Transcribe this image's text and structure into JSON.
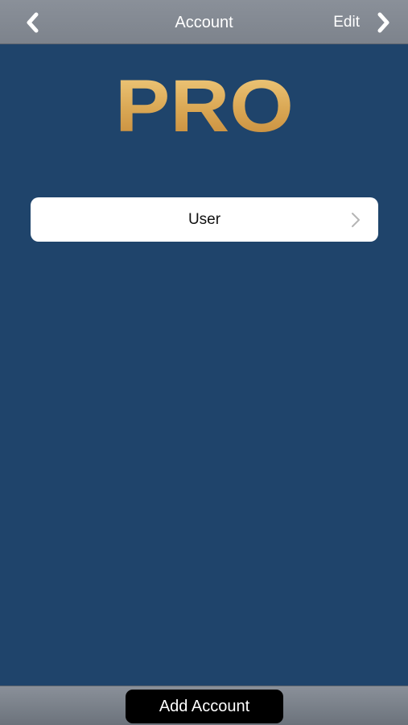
{
  "nav": {
    "back_icon": "chevron-left-icon",
    "title": "Account",
    "edit_label": "Edit",
    "edit_icon": "chevron-right-icon"
  },
  "brand": {
    "logo_text": "PRO",
    "logo_colors": [
      "#f0c87a",
      "#c98f3c"
    ]
  },
  "accounts": [
    {
      "label": "User",
      "icon": "chevron-right-icon"
    }
  ],
  "footer": {
    "add_account_label": "Add Account"
  },
  "colors": {
    "background": "#1f446b",
    "bar": "#858b94",
    "button": "#000000"
  }
}
